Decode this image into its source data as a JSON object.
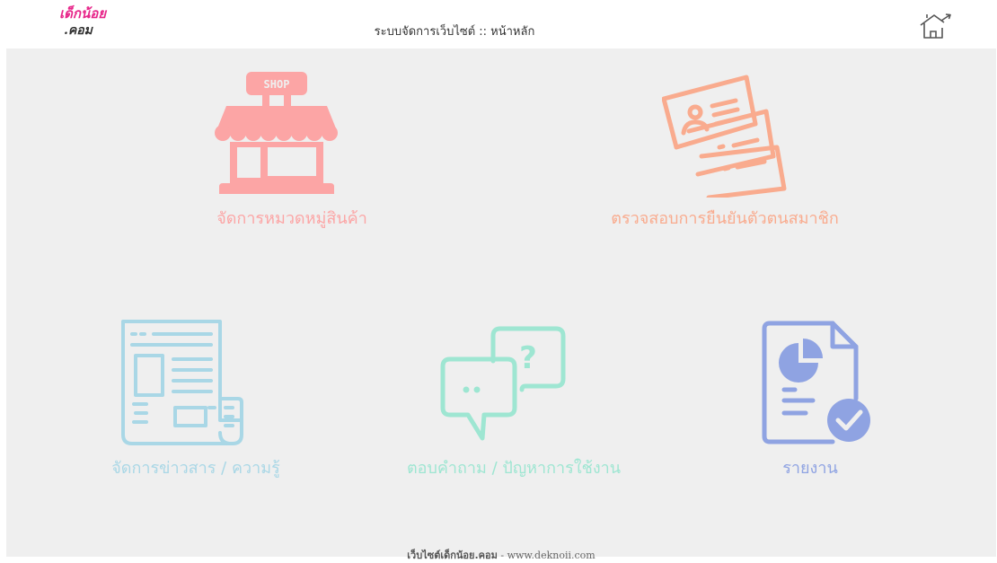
{
  "header": {
    "logo_line1": "เด็กน้อย",
    "logo_line2": ".คอม",
    "title": "ระบบจัดการเว็บไซต์ :: หน้าหลัก",
    "home_icon": "home-exit-icon"
  },
  "menu": [
    {
      "label": "จัดการหมวดหมู่สินค้า",
      "icon": "shop-icon",
      "color": "#fca5a5"
    },
    {
      "label": "ตรวจสอบการยืนยันตัวตนสมาชิก",
      "icon": "id-cards-icon",
      "color": "#f9ab8e"
    },
    {
      "label": "จัดการข่าวสาร / ความรู้",
      "icon": "newspaper-icon",
      "color": "#a9d7e6"
    },
    {
      "label": "ตอบคำถาม / ปัญหาการใช้งาน",
      "icon": "chat-question-icon",
      "color": "#9ee6d2"
    },
    {
      "label": "รายงาน",
      "icon": "report-icon",
      "color": "#8fa3e2"
    }
  ],
  "shop_sign_text": "SHOP",
  "footer": {
    "site_name": "เว็บไซต์เด็กน้อย.คอม",
    "separator": " - ",
    "url": "www.deknoii.com"
  },
  "colors": {
    "logo_pink": "#e7268a",
    "background": "#efefef",
    "header_bg": "#ffffff"
  }
}
